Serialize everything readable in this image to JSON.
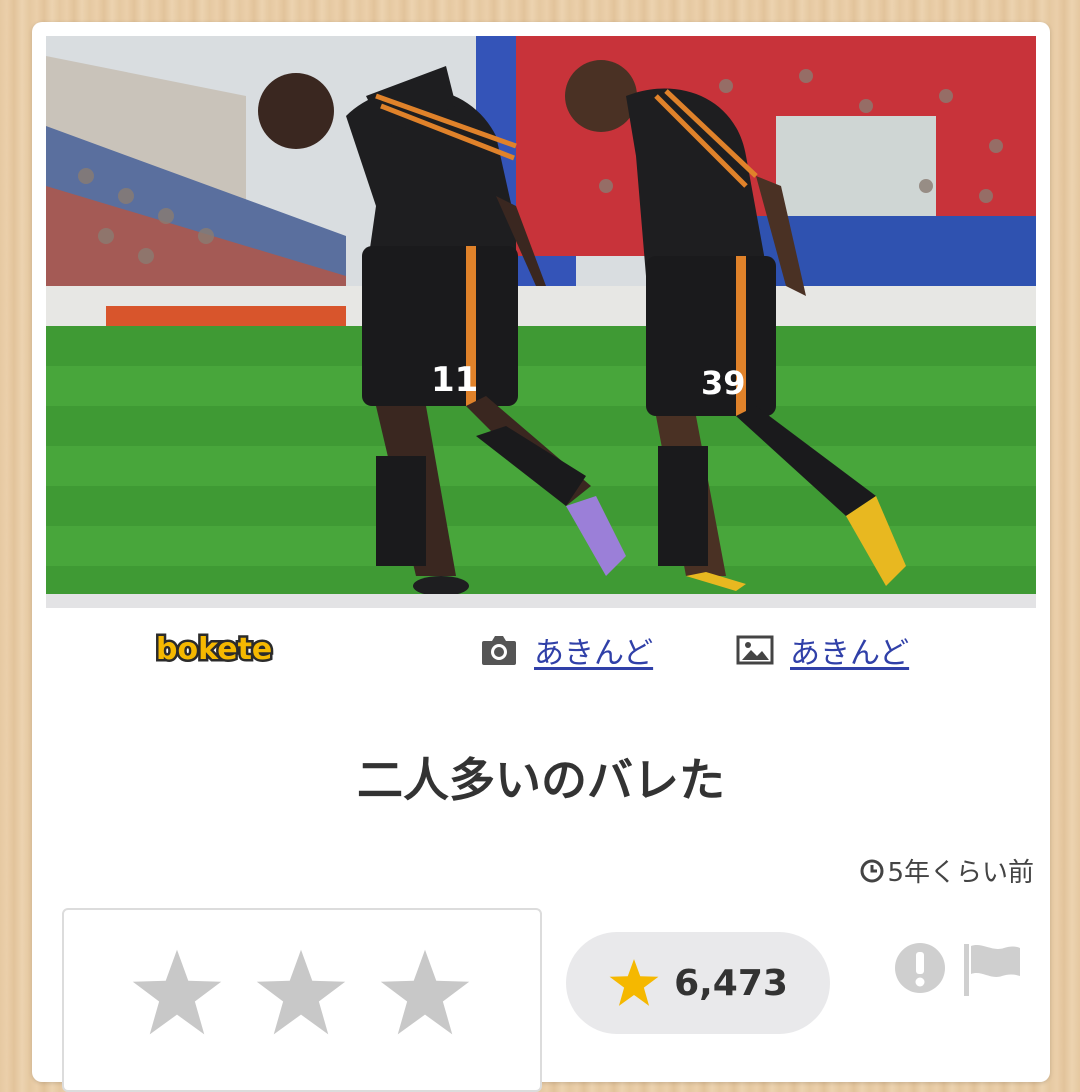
{
  "photo": {
    "description_icon": "soccer-photo",
    "jersey_numbers": [
      "11",
      "39"
    ]
  },
  "site": {
    "logo_text": "bokete",
    "logo_color": "#f5b800"
  },
  "credits": {
    "photo_author": "あきんど",
    "photo_author_icon": "camera-icon",
    "image_author": "あきんど",
    "image_author_icon": "image-icon"
  },
  "post": {
    "caption": "二人多いのバレた",
    "posted_ago": "5年くらい前",
    "time_icon": "clock-icon"
  },
  "rating": {
    "stars_total": 3,
    "stars_filled": 0,
    "star_color_empty": "#c8c8c8",
    "star_color_filled": "#f5b800",
    "vote_count": "6,473"
  },
  "actions": {
    "report_icon": "exclamation-icon",
    "flag_icon": "flag-icon"
  }
}
